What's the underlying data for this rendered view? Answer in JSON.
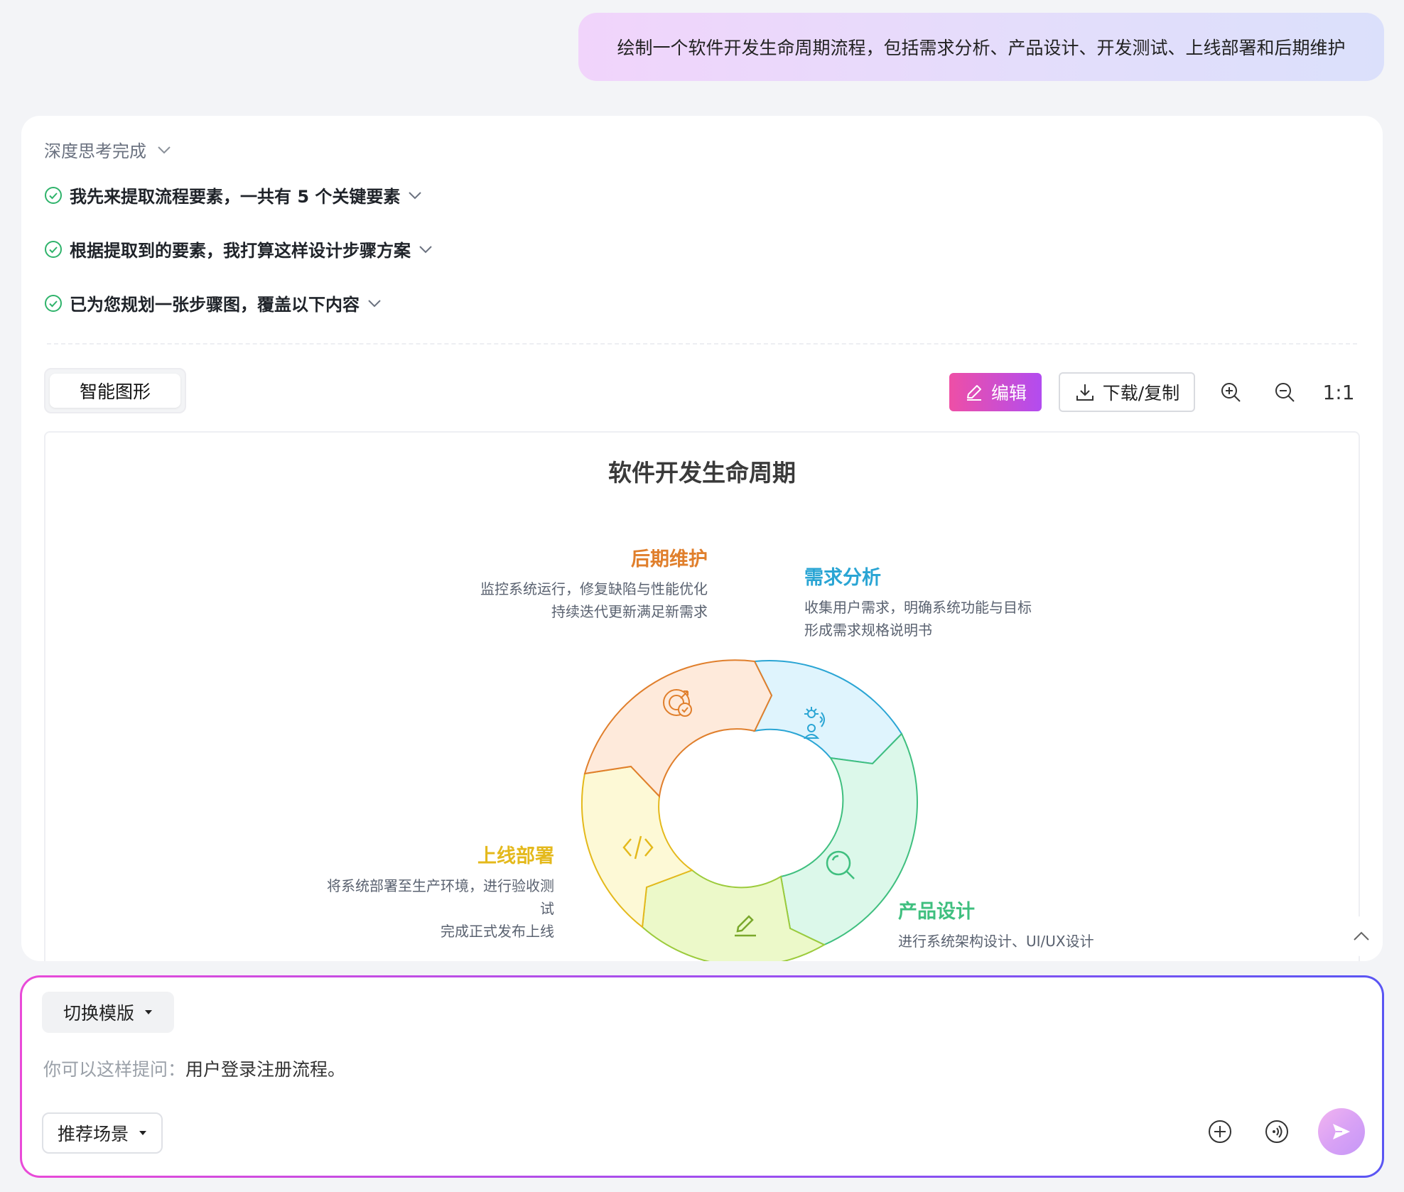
{
  "user_message": "绘制一个软件开发生命周期流程，包括需求分析、产品设计、开发测试、上线部署和后期维护",
  "thinking": {
    "header": "深度思考完成",
    "steps": [
      {
        "text": "我先来提取流程要素，一共有 5 个关键要素"
      },
      {
        "text": "根据提取到的要素，我打算这样设计步骤方案"
      },
      {
        "text": "已为您规划一张步骤图，覆盖以下内容"
      }
    ]
  },
  "tabs": {
    "active": "智能图形"
  },
  "toolbar": {
    "edit_label": "编辑",
    "download_label": "下载/复制",
    "zoom_in_icon": "zoom-in-icon",
    "zoom_out_icon": "zoom-out-icon",
    "ratio_label": "1:1"
  },
  "diagram": {
    "title": "软件开发生命周期",
    "segments": {
      "maintenance": {
        "label": "后期维护",
        "color": "#e07f2c",
        "desc1": "监控系统运行，修复缺陷与性能优化",
        "desc2": "持续迭代更新满足新需求",
        "icon": "target-check-icon"
      },
      "requirements": {
        "label": "需求分析",
        "color": "#2aa5d4",
        "desc1": "收集用户需求，明确系统功能与目标",
        "desc2": "形成需求规格说明书",
        "icon": "idea-person-icon"
      },
      "design": {
        "label": "产品设计",
        "color": "#3fbf7f",
        "desc1": "进行系统架构设计、UI/UX设计",
        "icon": "search-icon"
      },
      "deploy": {
        "label": "上线部署",
        "color": "#e4b91c",
        "desc1": "将系统部署至生产环境，进行验收测",
        "desc2": "试",
        "desc3": "完成正式发布上线",
        "icon": "code-icon"
      },
      "dev_test": {
        "color": "#9ccb3c",
        "icon": "pencil-icon"
      }
    }
  },
  "composer": {
    "template_label": "切换模版",
    "placeholder_prefix": "你可以这样提问：",
    "placeholder_example": "用户登录注册流程。",
    "scene_label": "推荐场景",
    "add_icon": "plus-circle-icon",
    "voice_icon": "voice-icon",
    "send_icon": "send-icon"
  }
}
